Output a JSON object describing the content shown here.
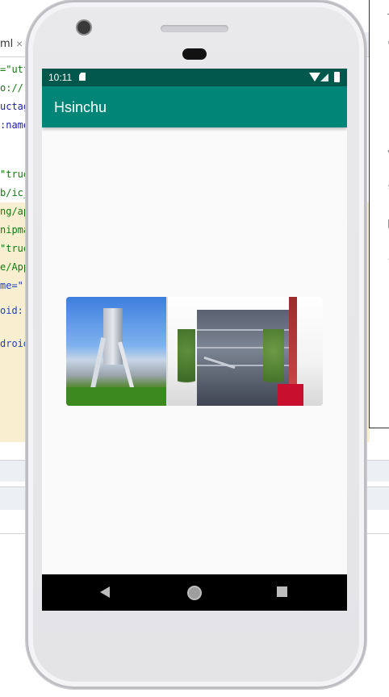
{
  "ide": {
    "tab_label": "ml",
    "tab_close": "×",
    "code_lines": [
      {
        "text": "=\"utf",
        "cls": "c-str"
      },
      {
        "text": "o://:",
        "cls": "c-str"
      },
      {
        "text": "uctag",
        "cls": "c-attr"
      },
      {
        "text": ":name",
        "cls": "c-attr"
      },
      {
        "text": "\"true",
        "cls": "c-str"
      },
      {
        "text": "b/ic_",
        "cls": "c-str"
      },
      {
        "text": "ng/ap",
        "cls": "c-str"
      },
      {
        "text": "nipma",
        "cls": "c-str"
      },
      {
        "text": "\"true",
        "cls": "c-str"
      },
      {
        "text": "e/App",
        "cls": "c-str"
      },
      {
        "text": "me=\"",
        "cls": "c-blue"
      },
      {
        "text": "oid:r",
        "cls": "c-blue"
      },
      {
        "text": "droid",
        "cls": "c-blue"
      }
    ],
    "right_panel_icons": [
      "minimize-icon",
      "gear-icon",
      "back-arrow-icon",
      "refresh-icon",
      "page-icon",
      "dot-icon"
    ]
  },
  "phone": {
    "status": {
      "time": "10:11"
    },
    "app_title": "Hsinchu",
    "colors": {
      "status_bar": "#00574b",
      "app_bar": "#008577",
      "screen_background": "#fafafa",
      "nav_bar": "#000000"
    },
    "nav": {
      "back_icon": "back-triangle-icon",
      "home_icon": "home-circle-icon",
      "recent_icon": "recents-square-icon"
    }
  }
}
